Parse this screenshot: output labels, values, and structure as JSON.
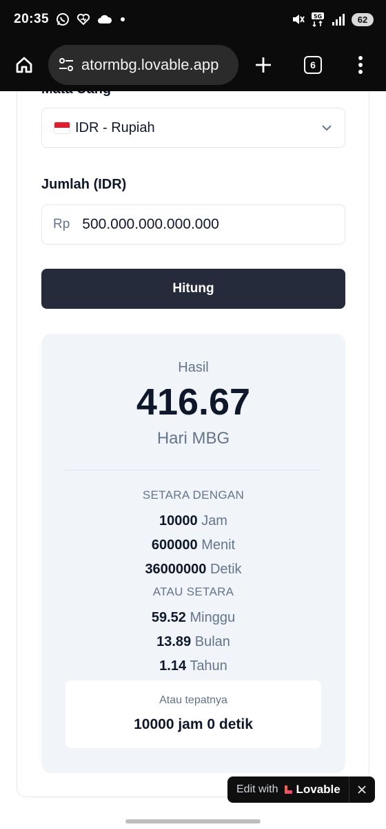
{
  "status_bar": {
    "time": "20:35",
    "battery": "62",
    "icons": [
      "whatsapp-icon",
      "heart-icon",
      "cloud-icon",
      "dot-icon",
      "mute-icon",
      "5g-icon",
      "signal-icon"
    ]
  },
  "browser": {
    "url": "atormbg.lovable.app",
    "tab_count": "6"
  },
  "form": {
    "currency_label": "Mata Uang",
    "currency_value": "IDR - Rupiah",
    "amount_label": "Jumlah (IDR)",
    "amount_prefix": "Rp",
    "amount_value": "500.000.000.000.000",
    "submit_label": "Hitung"
  },
  "result": {
    "label": "Hasil",
    "value": "416.67",
    "unit": "Hari MBG",
    "equivalent_header": "SETARA DENGAN",
    "equivalents": [
      {
        "num": "10000",
        "unit": "Jam"
      },
      {
        "num": "600000",
        "unit": "Menit"
      },
      {
        "num": "36000000",
        "unit": "Detik"
      }
    ],
    "alternative_header": "ATAU SETARA",
    "alternatives": [
      {
        "num": "59.52",
        "unit": "Minggu"
      },
      {
        "num": "13.89",
        "unit": "Bulan"
      },
      {
        "num": "1.14",
        "unit": "Tahun"
      }
    ],
    "exact_label": "Atau tepatnya",
    "exact_value": "10000 jam 0 detik"
  },
  "lovable_badge": {
    "edit_text": "Edit with",
    "brand": "Lovable"
  }
}
